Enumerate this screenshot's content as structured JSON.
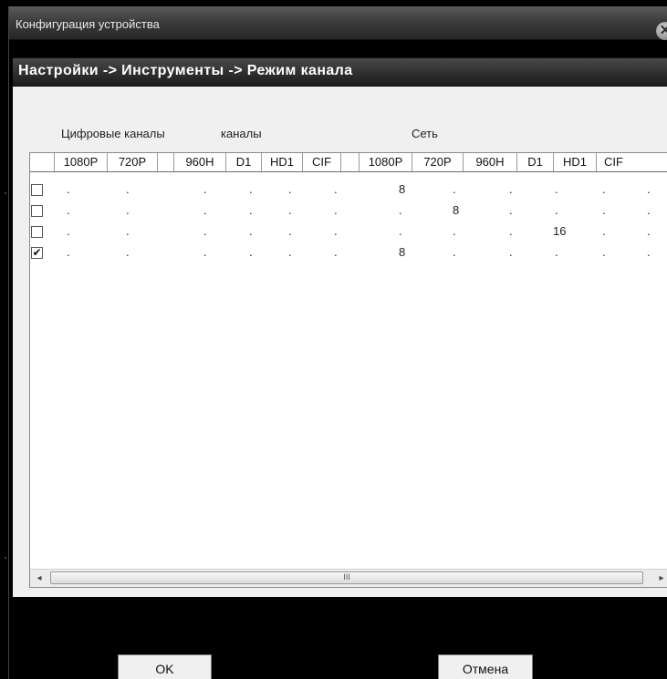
{
  "window": {
    "title": "Конфигурация устройства",
    "close_icon": "close-icon"
  },
  "breadcrumb": "Настройки -> Инструменты -> Режим канала",
  "groups": {
    "digital": "Цифровые каналы",
    "analog": "каналы",
    "network": "Сеть"
  },
  "columns": [
    "",
    "1080P",
    "720P",
    "",
    "960H",
    "D1",
    "HD1",
    "CIF",
    "",
    "1080P",
    "720P",
    "960H",
    "D1",
    "HD1",
    "CIF"
  ],
  "rows": [
    {
      "checked": false,
      "cells": [
        ".",
        ".",
        "",
        ".",
        ".",
        ".",
        ".",
        "",
        "8",
        ".",
        ".",
        ".",
        ".",
        "."
      ]
    },
    {
      "checked": false,
      "cells": [
        ".",
        ".",
        "",
        ".",
        ".",
        ".",
        ".",
        "",
        ".",
        "8",
        ".",
        ".",
        ".",
        "."
      ]
    },
    {
      "checked": false,
      "cells": [
        ".",
        ".",
        "",
        ".",
        ".",
        ".",
        ".",
        "",
        ".",
        ".",
        ".",
        "16",
        ".",
        "."
      ]
    },
    {
      "checked": true,
      "cells": [
        ".",
        ".",
        "",
        ".",
        ".",
        ".",
        ".",
        "",
        "8",
        ".",
        ".",
        ".",
        ".",
        "."
      ]
    }
  ],
  "scrollbar": {
    "left_arrow": "◂",
    "right_arrow": "▸",
    "thumb_grip": "III"
  },
  "buttons": {
    "ok": "OK",
    "cancel": "Отмена"
  },
  "colors": {
    "background": "#000000",
    "panel": "#f0f0f0",
    "titlebar": "#3d3d3d"
  }
}
